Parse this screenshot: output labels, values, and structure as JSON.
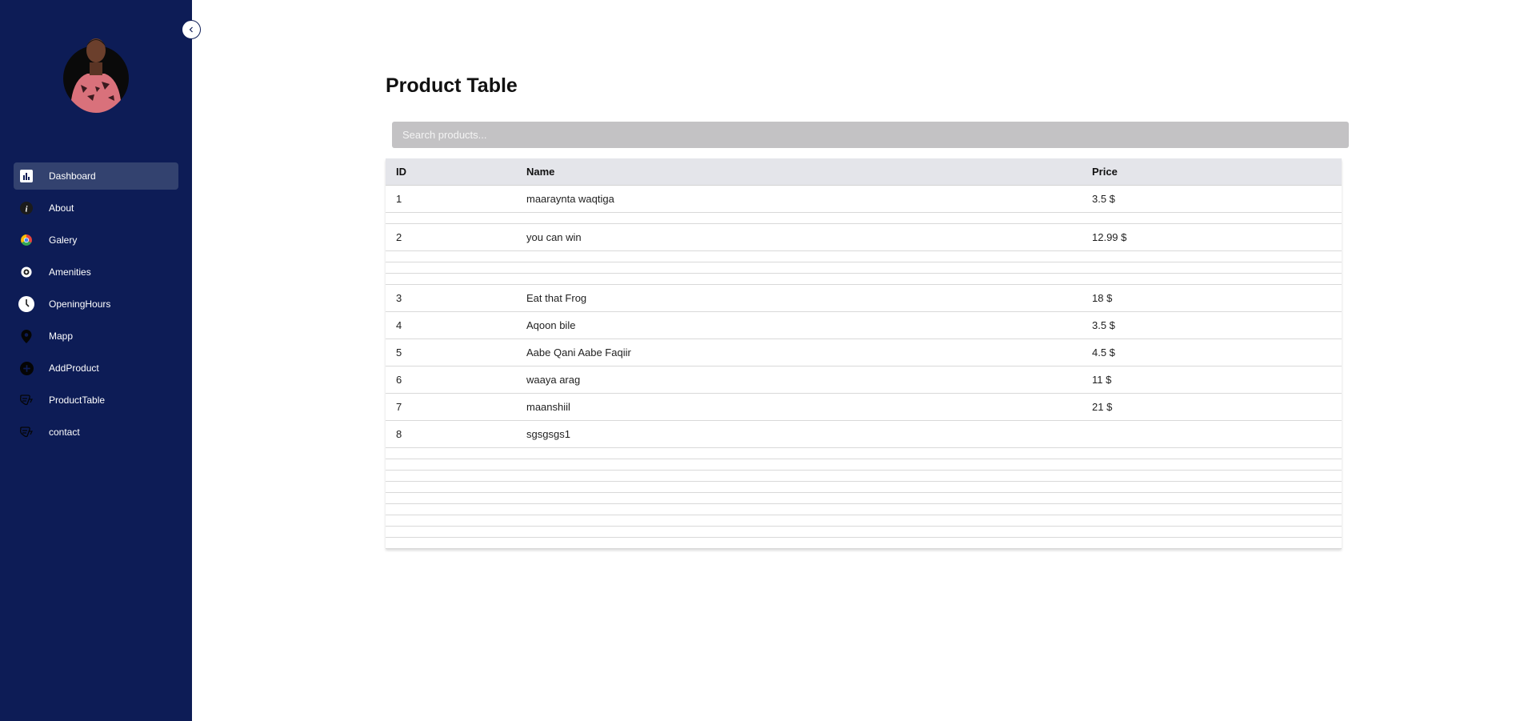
{
  "sidebar": {
    "items": [
      {
        "label": "Dashboard",
        "icon": "bar-chart-icon",
        "active": true
      },
      {
        "label": "About",
        "icon": "info-icon"
      },
      {
        "label": "Galery",
        "icon": "chrome-icon"
      },
      {
        "label": "Amenities",
        "icon": "target-icon"
      },
      {
        "label": "OpeningHours",
        "icon": "clock-icon"
      },
      {
        "label": "Mapp",
        "icon": "map-pin-icon"
      },
      {
        "label": "AddProduct",
        "icon": "plus-circle-icon"
      },
      {
        "label": "ProductTable",
        "icon": "table-icon"
      },
      {
        "label": "contact",
        "icon": "contact-icon"
      }
    ]
  },
  "main": {
    "title": "Product Table",
    "search": {
      "placeholder": "Search products...",
      "value": ""
    },
    "table": {
      "headers": [
        "ID",
        "Name",
        "Price"
      ],
      "rows": [
        {
          "id": "1",
          "name": "maaraynta waqtiga",
          "price": "3.5 $"
        },
        {
          "empty": true
        },
        {
          "id": "2",
          "name": "you can win",
          "price": "12.99 $"
        },
        {
          "empty": true
        },
        {
          "empty": true
        },
        {
          "empty": true
        },
        {
          "id": "3",
          "name": "Eat that Frog",
          "price": "18 $"
        },
        {
          "id": "4",
          "name": "Aqoon bile",
          "price": "3.5 $"
        },
        {
          "id": "5",
          "name": "Aabe Qani Aabe Faqiir",
          "price": "4.5 $"
        },
        {
          "id": "6",
          "name": "waaya arag",
          "price": "11 $"
        },
        {
          "id": "7",
          "name": "maanshiil",
          "price": "21 $"
        },
        {
          "id": "8",
          "name": "sgsgsgs1",
          "price": ""
        },
        {
          "empty": true
        },
        {
          "empty": true
        },
        {
          "empty": true
        },
        {
          "empty": true
        },
        {
          "empty": true
        },
        {
          "empty": true
        },
        {
          "empty": true
        },
        {
          "empty": true
        },
        {
          "empty": true
        }
      ]
    }
  },
  "colors": {
    "sidebar_bg": "#0d1c56",
    "active_item_bg": "#33426f",
    "search_bg": "#c3c2c4",
    "header_bg": "#e4e5ea"
  }
}
